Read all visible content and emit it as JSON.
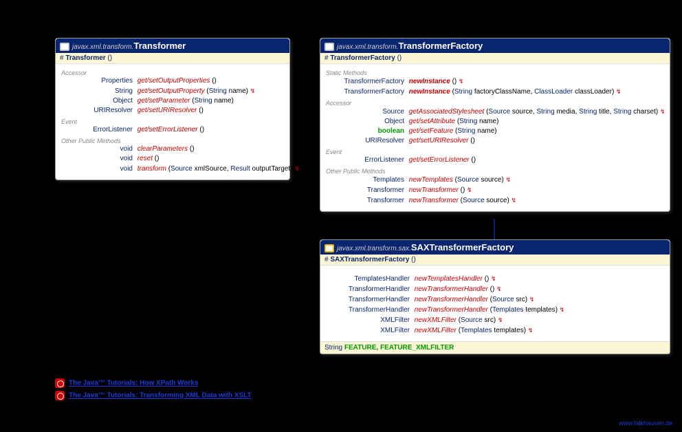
{
  "transformer": {
    "pkg": "javax.xml.transform.",
    "cls": "Transformer",
    "ctor": "Transformer",
    "s1": "Accessor",
    "r1_rt": "Properties",
    "r1_m": "get/setOutputProperties",
    "r1_p": "()",
    "r2_rt": "String",
    "r2_m": "get/setOutputProperty",
    "r2_p1t": "String",
    "r2_p1n": " name",
    "r2_ex": "↯",
    "r3_rt": "Object",
    "r3_m": "get/setParameter",
    "r3_p1t": "String",
    "r3_p1n": " name",
    "r4_rt": "URIResolver",
    "r4_m": "get/setURIResolver",
    "r4_p": "()",
    "s2": "Event",
    "r5_rt": "ErrorListener",
    "r5_m": "get/setErrorListener",
    "r5_p": "()",
    "s3": "Other Public Methods",
    "r6_rt": "void",
    "r6_m": "clearParameters",
    "r6_p": "()",
    "r7_rt": "void",
    "r7_m": "reset",
    "r7_p": "()",
    "r8_rt": "void",
    "r8_m": "transform",
    "r8_p1t": "Source",
    "r8_p1n": " xmlSource",
    "r8_p2t": "Result",
    "r8_p2n": " outputTarget",
    "r8_ex": "↯"
  },
  "factory": {
    "pkg": "javax.xml.transform.",
    "cls": "TransformerFactory",
    "ctor": "TransformerFactory",
    "s1": "Static Methods",
    "r1_rt": "TransformerFactory",
    "r1_m": "newInstance",
    "r1_p": "()",
    "r1_ex": "↯",
    "r2_rt": "TransformerFactory",
    "r2_m": "newInstance",
    "r2_p1t": "String",
    "r2_p1n": " factoryClassName",
    "r2_p2t": "ClassLoader",
    "r2_p2n": " classLoader",
    "r2_ex": "↯",
    "s2": "Accessor",
    "r3_rt": "Source",
    "r3_m": "getAssociatedStylesheet",
    "r3_p1t": "Source",
    "r3_p1n": " source",
    "r3_p2t": "String",
    "r3_p2n": " media",
    "r3_p3t": "String",
    "r3_p3n": " title",
    "r3_p4t": "String",
    "r3_p4n": " charset",
    "r3_ex": "↯",
    "r4_rt": "Object",
    "r4_m": "get/setAttribute",
    "r4_p1t": "String",
    "r4_p1n": " name",
    "r5_rt": "boolean",
    "r5_m": "get/setFeature",
    "r5_p1t": "String",
    "r5_p1n": " name",
    "r6_rt": "URIResolver",
    "r6_m": "get/setURIResolver",
    "r6_p": "()",
    "s3": "Event",
    "r7_rt": "ErrorListener",
    "r7_m": "get/setErrorListener",
    "r7_p": "()",
    "s4": "Other Public Methods",
    "r8_rt": "Templates",
    "r8_m": "newTemplates",
    "r8_p1t": "Source",
    "r8_p1n": " source",
    "r8_ex": "↯",
    "r9_rt": "Transformer",
    "r9_m": "newTransformer",
    "r9_p": "()",
    "r9_ex": "↯",
    "r10_rt": "Transformer",
    "r10_m": "newTransformer",
    "r10_p1t": "Source",
    "r10_p1n": " source",
    "r10_ex": "↯"
  },
  "sax": {
    "pkg": "javax.xml.transform.sax.",
    "cls": "SAXTransformerFactory",
    "ctor": "SAXTransformerFactory",
    "r1_rt": "TemplatesHandler",
    "r1_m": "newTemplatesHandler",
    "r1_p": "()",
    "r1_ex": "↯",
    "r2_rt": "TransformerHandler",
    "r2_m": "newTransformerHandler",
    "r2_p": "()",
    "r2_ex": "↯",
    "r3_rt": "TransformerHandler",
    "r3_m": "newTransformerHandler",
    "r3_p1t": "Source",
    "r3_p1n": " src",
    "r3_ex": "↯",
    "r4_rt": "TransformerHandler",
    "r4_m": "newTransformerHandler",
    "r4_p1t": "Templates",
    "r4_p1n": " templates",
    "r4_ex": "↯",
    "r5_rt": "XMLFilter",
    "r5_m": "newXMLFilter",
    "r5_p1t": "Source",
    "r5_p1n": " src",
    "r5_ex": "↯",
    "r6_rt": "XMLFilter",
    "r6_m": "newXMLFilter",
    "r6_p1t": "Templates",
    "r6_p1n": " templates",
    "r6_ex": "↯",
    "ftr_t": "String",
    "ftr_v": "FEATURE, FEATURE_XMLFILTER"
  },
  "links": {
    "l1": "The Java™ Tutorials: How XPath Works",
    "l2": "The Java™ Tutorials: Transforming XML Data with XSLT"
  },
  "credit": "www.falkhausen.de"
}
